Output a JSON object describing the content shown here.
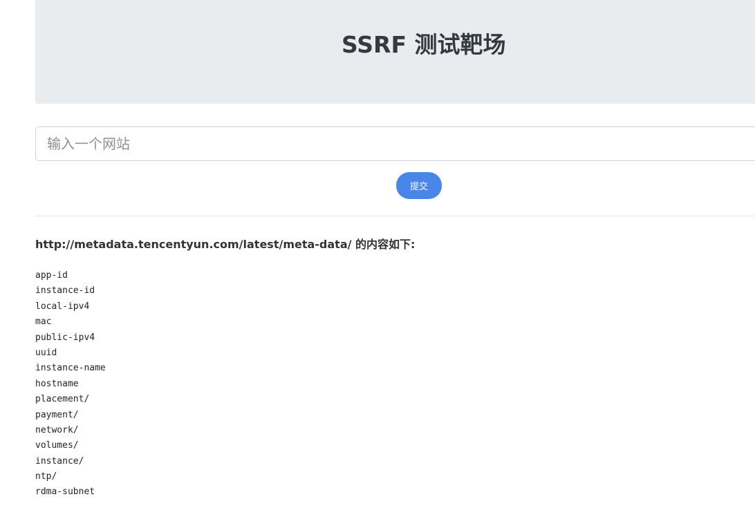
{
  "header": {
    "title": "SSRF 测试靶场"
  },
  "form": {
    "url_placeholder": "输入一个网站",
    "submit_label": "提交"
  },
  "result": {
    "url": "http://metadata.tencentyun.com/latest/meta-data/",
    "suffix": " 的内容如下:",
    "items": [
      "app-id",
      "instance-id",
      "local-ipv4",
      "mac",
      "public-ipv4",
      "uuid",
      "instance-name",
      "hostname",
      "placement/",
      "payment/",
      "network/",
      "volumes/",
      "instance/",
      "ntp/",
      "rdma-subnet"
    ]
  },
  "colors": {
    "hero_bg": "#e9ecef",
    "button_bg": "#4a86e8"
  }
}
